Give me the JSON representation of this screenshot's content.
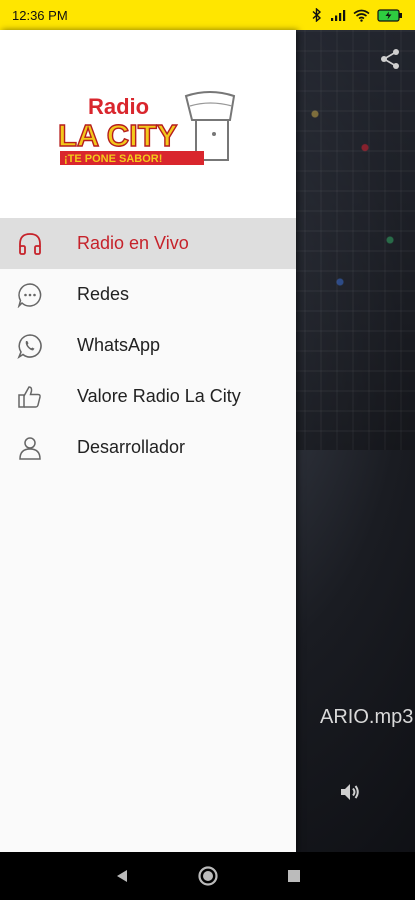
{
  "status_bar": {
    "time": "12:36 PM",
    "icons": [
      "bluetooth-icon",
      "signal-icon",
      "wifi-icon",
      "battery-charging-icon"
    ]
  },
  "drawer": {
    "logo": {
      "line1": "Radio",
      "line2": "LA CITY",
      "tagline": "¡TE PONE SABOR!"
    },
    "menu": [
      {
        "label": "Radio en Vivo",
        "icon": "headphones-icon",
        "active": true
      },
      {
        "label": "Redes",
        "icon": "chat-bubble-icon",
        "active": false
      },
      {
        "label": "WhatsApp",
        "icon": "whatsapp-icon",
        "active": false
      },
      {
        "label": "Valore Radio La City",
        "icon": "thumbs-up-icon",
        "active": false
      },
      {
        "label": "Desarrollador",
        "icon": "person-icon",
        "active": false
      }
    ]
  },
  "player": {
    "track_name": "ARIO.mp3",
    "share_icon": "share-icon",
    "volume_icon": "volume-icon"
  },
  "navbar": {
    "buttons": [
      "back-icon",
      "home-icon",
      "recents-icon"
    ]
  },
  "colors": {
    "status_bar": "#ffe600",
    "accent": "#c6222a",
    "active_item_bg": "#dedede"
  }
}
